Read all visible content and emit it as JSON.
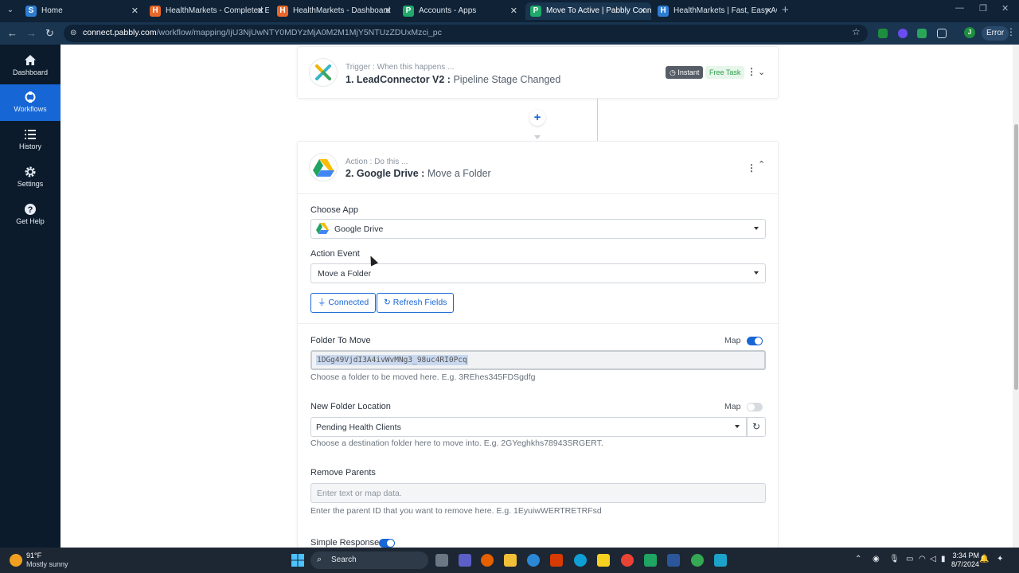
{
  "browser": {
    "tabs": [
      {
        "title": "Home",
        "favicon_color": "#2d7dd2"
      },
      {
        "title": "HealthMarkets - Completed En",
        "favicon_color": "#e8672a"
      },
      {
        "title": "HealthMarkets - Dashboard",
        "favicon_color": "#e8672a"
      },
      {
        "title": "Accounts - Apps",
        "favicon_color": "#20a96b"
      },
      {
        "title": "Move To Active | Pabbly Conne",
        "favicon_color": "#20a96b"
      },
      {
        "title": "HealthMarkets | Fast, Easy ACA",
        "favicon_color": "#2d7dd2"
      }
    ],
    "url_host": "connect.pabbly.com",
    "url_path": "/workflow/mapping/IjU3NjUwNTY0MDYzMjA0M2M1MjY5NTUzZDUxMzci_pc",
    "profile_initial": "J",
    "error_label": "Error"
  },
  "sidebar": {
    "items": [
      {
        "label": "Dashboard",
        "icon": "home-icon"
      },
      {
        "label": "Workflows",
        "icon": "workflows-icon",
        "active": true
      },
      {
        "label": "History",
        "icon": "list-icon"
      },
      {
        "label": "Settings",
        "icon": "gear-icon"
      },
      {
        "label": "Get Help",
        "icon": "help-icon"
      }
    ]
  },
  "trigger": {
    "subtitle": "Trigger : When this happens ...",
    "title": "1. LeadConnector V2 :",
    "event": "Pipeline Stage Changed",
    "badge_instant": "Instant",
    "badge_free": "Free Task"
  },
  "action": {
    "subtitle": "Action : Do this ...",
    "title": "2. Google Drive :",
    "event": "Move a Folder",
    "choose_app_label": "Choose App",
    "choose_app_value": "Google Drive",
    "action_event_label": "Action Event",
    "action_event_value": "Move a Folder",
    "connected_label": "Connected",
    "refresh_label": "Refresh Fields",
    "map_label": "Map",
    "folder_to_move": {
      "label": "Folder To Move",
      "value": "1DGg49VjdI3A4ivWvMNg3_98uc4RI0Pcq",
      "help": "Choose a folder to be moved here. E.g. 3REhes345FDSgdfg",
      "map_on": true
    },
    "new_folder_location": {
      "label": "New Folder Location",
      "value": "Pending Health Clients",
      "help": "Choose a destination folder here to move into. E.g. 2GYeghkhs78943SRGERT.",
      "map_on": false
    },
    "remove_parents": {
      "label": "Remove Parents",
      "placeholder": "Enter text or map data.",
      "help": "Enter the parent ID that you want to remove here. E.g. 1EyuiwWERTRETRFsd"
    },
    "simple_response": {
      "label": "Simple Response",
      "on": true
    }
  },
  "taskbar": {
    "weather_temp": "91°F",
    "weather_desc": "Mostly sunny",
    "search_label": "Search",
    "time": "3:34 PM",
    "date": "8/7/2024"
  }
}
